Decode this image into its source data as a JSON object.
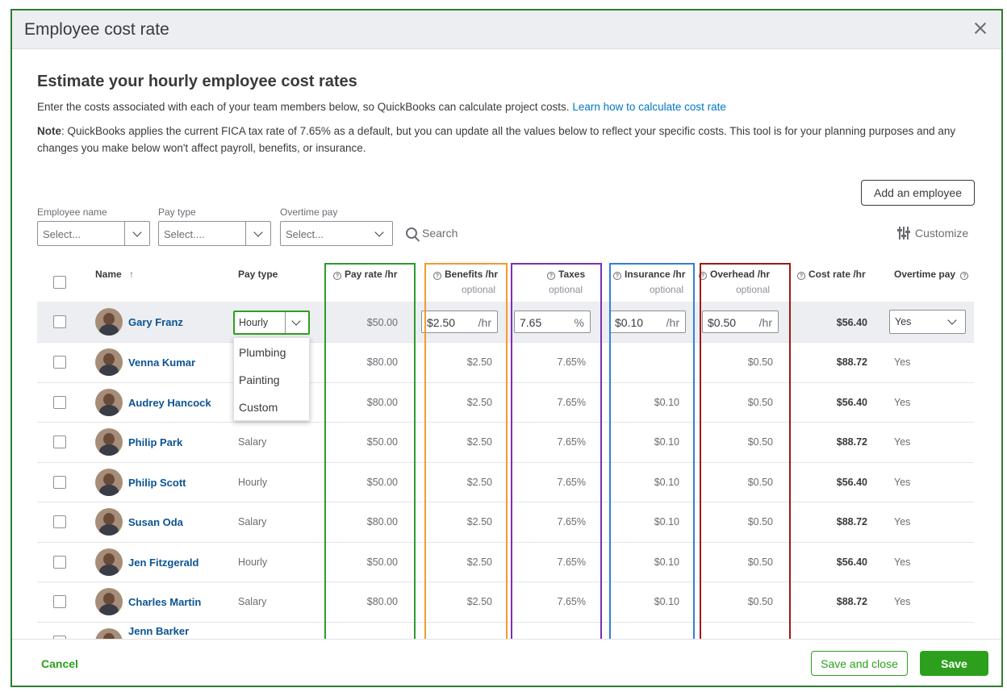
{
  "modal": {
    "title": "Employee cost rate"
  },
  "intro": {
    "heading": "Estimate your hourly employee cost rates",
    "text": "Enter the costs associated with each of your team members below, so QuickBooks can calculate project costs.",
    "link": "Learn how to calculate cost rate",
    "note_label": "Note",
    "note_text": ": QuickBooks applies the current FICA tax rate of 7.65% as a default, but you can update all the values below to reflect your specific costs. This tool is for your planning purposes and any changes you make below won't affect payroll, benefits, or insurance."
  },
  "actions": {
    "add_employee": "Add an employee",
    "search": "Search",
    "customize": "Customize"
  },
  "filters": [
    {
      "label": "Employee name",
      "placeholder": "Select..."
    },
    {
      "label": "Pay type",
      "placeholder": "Select...."
    },
    {
      "label": "Overtime pay",
      "placeholder": "Select..."
    }
  ],
  "columns": {
    "name": "Name",
    "name_sort": "↑",
    "pay_type": "Pay type",
    "pay_rate": "Pay rate /hr",
    "benefits": "Benefits /hr",
    "taxes": "Taxes",
    "insurance": "Insurance /hr",
    "overhead": "Overhead /hr",
    "cost_rate": "Cost rate /hr",
    "overtime": "Overtime pay",
    "optional": "optional"
  },
  "selected_row": {
    "name": "Gary Franz",
    "pay_type": "Hourly",
    "pay_rate": "$50.00",
    "benefits": "$2.50",
    "benefits_unit": "/hr",
    "taxes": "7.65",
    "taxes_unit": "%",
    "insurance": "$0.10",
    "insurance_unit": "/hr",
    "overhead": "$0.50",
    "overhead_unit": "/hr",
    "cost_rate": "$56.40",
    "overtime": "Yes"
  },
  "pay_type_menu": [
    "Plumbing",
    "Painting",
    "Custom"
  ],
  "rows": [
    {
      "name": "Venna Kumar",
      "pay_type": "",
      "pay_rate": "$80.00",
      "benefits": "$2.50",
      "taxes": "7.65%",
      "insurance": "",
      "overhead": "$0.50",
      "cost_rate": "$88.72",
      "overtime": "Yes"
    },
    {
      "name": "Audrey Hancock",
      "pay_type": "",
      "pay_rate": "$80.00",
      "benefits": "$2.50",
      "taxes": "7.65%",
      "insurance": "$0.10",
      "overhead": "$0.50",
      "cost_rate": "$56.40",
      "overtime": "Yes"
    },
    {
      "name": "Philip Park",
      "pay_type": "Salary",
      "pay_rate": "$50.00",
      "benefits": "$2.50",
      "taxes": "7.65%",
      "insurance": "$0.10",
      "overhead": "$0.50",
      "cost_rate": "$88.72",
      "overtime": "Yes"
    },
    {
      "name": "Philip Scott",
      "pay_type": "Hourly",
      "pay_rate": "$50.00",
      "benefits": "$2.50",
      "taxes": "7.65%",
      "insurance": "$0.10",
      "overhead": "$0.50",
      "cost_rate": "$56.40",
      "overtime": "Yes"
    },
    {
      "name": "Susan Oda",
      "pay_type": "Salary",
      "pay_rate": "$80.00",
      "benefits": "$2.50",
      "taxes": "7.65%",
      "insurance": "$0.10",
      "overhead": "$0.50",
      "cost_rate": "$88.72",
      "overtime": "Yes"
    },
    {
      "name": "Jen Fitzgerald",
      "pay_type": "Hourly",
      "pay_rate": "$50.00",
      "benefits": "$2.50",
      "taxes": "7.65%",
      "insurance": "$0.10",
      "overhead": "$0.50",
      "cost_rate": "$56.40",
      "overtime": "Yes"
    },
    {
      "name": "Charles Martin",
      "pay_type": "Salary",
      "pay_rate": "$80.00",
      "benefits": "$2.50",
      "taxes": "7.65%",
      "insurance": "$0.10",
      "overhead": "$0.50",
      "cost_rate": "$88.72",
      "overtime": "Yes"
    }
  ],
  "partial_row": {
    "name": "Jenn Barker"
  },
  "footer": {
    "cancel": "Cancel",
    "save_close": "Save and close",
    "save": "Save"
  },
  "highlight_colors": [
    "#2e9a2e",
    "#f39a2e",
    "#7a2fb5",
    "#2f80d8",
    "#a01818"
  ],
  "icons": [
    "close-icon",
    "chevron-down-icon",
    "search-icon",
    "sliders-icon",
    "help-circle-icon",
    "sort-arrow-icon",
    "avatar"
  ]
}
